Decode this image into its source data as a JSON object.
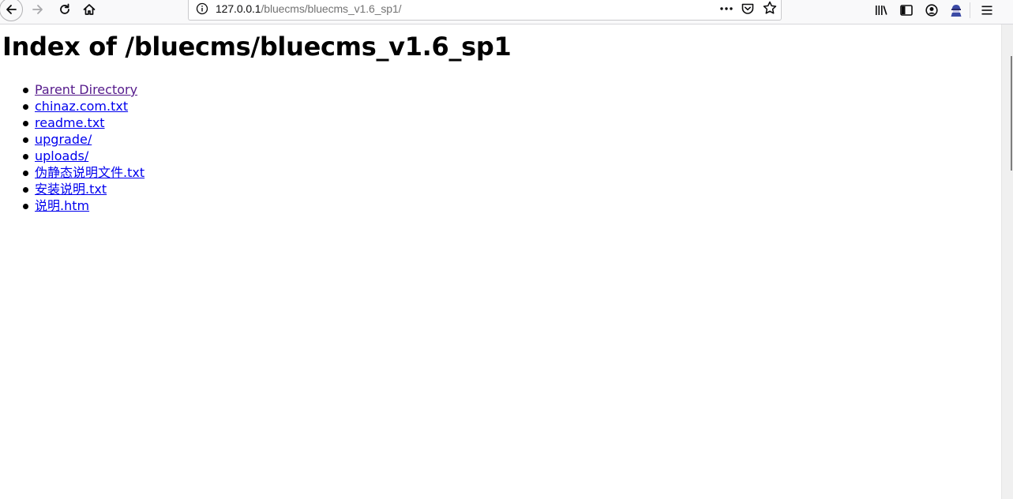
{
  "browser": {
    "url_host": "127.0.0.1",
    "url_path": "/bluecms/bluecms_v1.6_sp1/",
    "icons": {
      "back": "back-arrow-icon",
      "forward": "forward-arrow-icon",
      "reload": "reload-icon",
      "home": "home-icon",
      "site_info": "info-icon",
      "page_actions": "ellipsis-icon",
      "pocket": "pocket-icon",
      "bookmark": "star-icon",
      "library": "library-icon",
      "sidebar": "sidebar-icon",
      "account": "account-icon",
      "extension": "extension-icon",
      "menu": "hamburger-menu-icon"
    }
  },
  "page": {
    "title": "Index of /bluecms/bluecms_v1.6_sp1",
    "entries": [
      {
        "label": "Parent Directory",
        "visited": true
      },
      {
        "label": "chinaz.com.txt",
        "visited": false
      },
      {
        "label": "readme.txt",
        "visited": false
      },
      {
        "label": "upgrade/",
        "visited": false
      },
      {
        "label": "uploads/",
        "visited": false
      },
      {
        "label": "伪静态说明文件.txt",
        "visited": false
      },
      {
        "label": "安装说明.txt",
        "visited": false
      },
      {
        "label": "说明.htm",
        "visited": false
      }
    ]
  },
  "colors": {
    "link": "#0000ee",
    "visited_link": "#551a8b",
    "toolbar_bg": "#f9f9fa"
  }
}
